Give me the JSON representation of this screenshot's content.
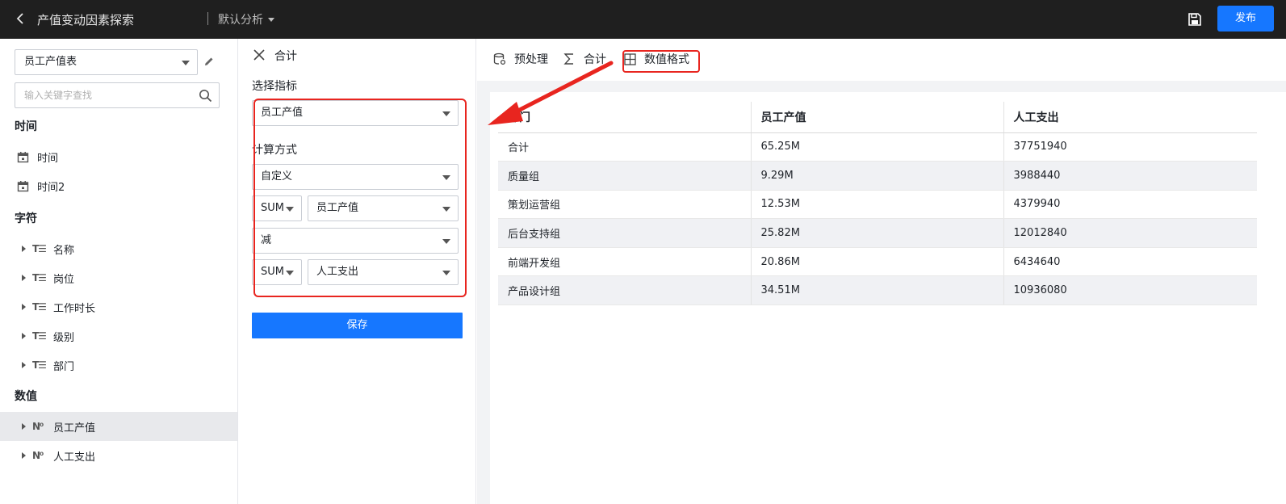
{
  "header": {
    "title": "产值变动因素探索",
    "analysis_label": "默认分析",
    "publish_label": "发布"
  },
  "left_panel": {
    "table_select_value": "员工产值表",
    "search_placeholder": "输入关键字查找",
    "sections": {
      "time": "时间",
      "character": "字符",
      "numeric": "数值"
    },
    "time_fields": [
      "时间",
      "时间2"
    ],
    "char_fields": [
      "名称",
      "岗位",
      "工作时长",
      "级别",
      "部门"
    ],
    "char_icon": "T☰",
    "num_fields": [
      "员工产值",
      "人工支出"
    ],
    "num_icon": "N⁰"
  },
  "middle_panel": {
    "title": "合计",
    "select_metric_label": "选择指标",
    "metric_value": "员工产值",
    "calc_method_label": "计算方式",
    "calc_method_value": "自定义",
    "row1_agg": "SUM",
    "row1_field": "员工产值",
    "operator": "减",
    "row2_agg": "SUM",
    "row2_field": "人工支出",
    "save_label": "保存"
  },
  "toolbar": {
    "preprocess": "预处理",
    "sum": "合计",
    "number_format": "数值格式"
  },
  "table": {
    "columns": [
      "部门",
      "员工产值",
      "人工支出"
    ],
    "rows": [
      [
        "合计",
        "65.25M",
        "37751940"
      ],
      [
        "质量组",
        "9.29M",
        "3988440"
      ],
      [
        "策划运营组",
        "12.53M",
        "4379940"
      ],
      [
        "后台支持组",
        "25.82M",
        "12012840"
      ],
      [
        "前端开发组",
        "20.86M",
        "6434640"
      ],
      [
        "产品设计组",
        "34.51M",
        "10936080"
      ]
    ]
  },
  "colors": {
    "accent": "#1677ff",
    "annotation": "#e8251f",
    "topbar": "#1f1f1f"
  }
}
